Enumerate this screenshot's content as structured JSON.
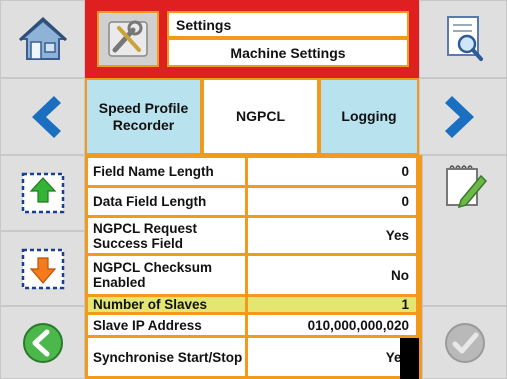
{
  "header": {
    "title": "Settings",
    "subtitle": "Machine Settings"
  },
  "tabs": [
    {
      "label": "Speed Profile Recorder",
      "active": false
    },
    {
      "label": "NGPCL",
      "active": true
    },
    {
      "label": "Logging",
      "active": false
    }
  ],
  "rows": [
    {
      "label": "Field Name Length",
      "value": "0",
      "highlight": false
    },
    {
      "label": "Data Field Length",
      "value": "0",
      "highlight": false
    },
    {
      "label": "NGPCL Request Success Field",
      "value": "Yes",
      "highlight": false
    },
    {
      "label": "NGPCL Checksum Enabled",
      "value": "No",
      "highlight": false
    },
    {
      "label": "Number of Slaves",
      "value": "1",
      "highlight": true
    },
    {
      "label": "Slave IP Address",
      "value": "010,000,000,020",
      "highlight": false
    },
    {
      "label": "Synchronise Start/Stop",
      "value": "Yes",
      "highlight": false
    }
  ],
  "icons": {
    "left": [
      "home-icon",
      "chevron-left-icon",
      "page-up-icon",
      "page-down-icon",
      "back-arrow-icon"
    ],
    "right": [
      "print-preview-icon",
      "chevron-right-icon",
      "edit-notepad-icon",
      "confirm-check-icon"
    ],
    "header": "settings-tools-icon"
  },
  "colors": {
    "accent": "#f39a1d",
    "header": "#e02020",
    "tab": "#b8e2ee",
    "highlight": "#e5e572",
    "nav": "#1a6fc0"
  }
}
